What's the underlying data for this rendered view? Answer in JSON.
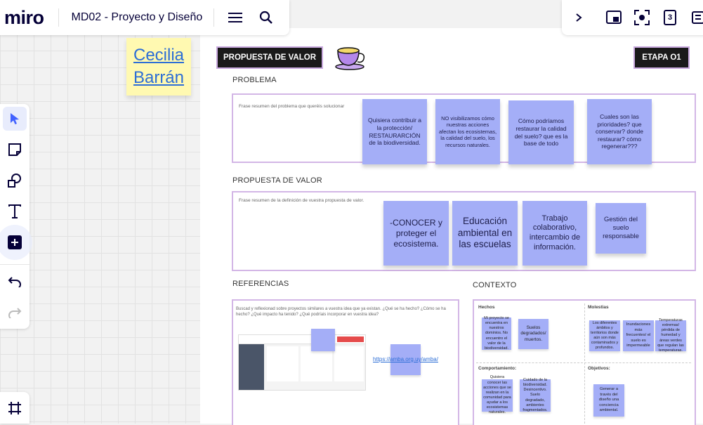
{
  "app": {
    "logo": "miro",
    "board_title": "MD02 - Proyecto y Diseño"
  },
  "colors": {
    "sticky_blue": "#a4aef7",
    "sticky_yellow": "#fff9b1",
    "frame_border": "#d3b6e6",
    "tag_bg": "#1a1a1a",
    "tool_active": "#4262ff"
  },
  "right_toolbar": {
    "chevron": "chevron-right-icon",
    "count": "3"
  },
  "name_note": {
    "line1": "Cecilia",
    "line2": "Barrán"
  },
  "tags": {
    "propuesta": "PROPUESTA DE VALOR",
    "etapa": "ETAPA O1"
  },
  "problema": {
    "label": "PROBLEMA",
    "hint": "Frase resumen del problema que queréis solucionar",
    "notes": [
      "Quisiera contribuir a la protección/ RESTAURARCIÓN de la biodiversidad.",
      "NO visibilizamos cómo nuestras acciones afectan los ecosistemas, la calidad del suelo, los recursos naturales.",
      "Cómo podríamos restaurar la calidad del suelo? que es la base de todo",
      "Cuales son las prioridades? que conservar? donde restaurar? cómo regenerar???"
    ]
  },
  "propuesta": {
    "label": "PROPUESTA DE VALOR",
    "hint": "Frase resumen de la definición de vuestra propuesta de valor.",
    "notes": [
      "-CONOCER y proteger el ecosistema.",
      "Educación ambiental en las escuelas",
      "Trabajo colaborativo, intercambio de información.",
      "Gestión del suelo responsable"
    ]
  },
  "referencias": {
    "label": "REFERENCIAS",
    "hint": "Buscad y reflexionad sobre proyectos similares a vuestra idea que ya existan. ¿Qué se ha hecho? ¿Cómo se ha hecho? ¿Qué impacto ha tenido? ¿Qué podríais incorporar en vuestra idea?",
    "link_note": "https://amba.org.uy/amba/"
  },
  "contexto": {
    "label": "CONTEXTO",
    "hechos": {
      "title": "Hechos",
      "notes": [
        "Mi proyecto se encuentra en nuestros dominios. No encuentro el valor de la biodiversidad.",
        "Suelos degradados/ muertos."
      ]
    },
    "molestias": {
      "title": "Molestias",
      "notes": [
        "Los diferentes ámbitos y territorios donde aún son más contaminados y profundos.",
        "Inundaciones más frecuentes/ el suelo es impermeable",
        "Temperaturas extremas/ pérdida de humedad y áreas verdes que regulan las temperaturas."
      ]
    },
    "comportamiento": {
      "title": "Comportamiento:",
      "notes": [
        "Quisiera conocer las acciones que se realizan en la comunidad para ayudar a los ecosistemas naturales.",
        "Cuidado de la biodiversidad. Desincentivo. Suelo degradado, ambientes fragmentados."
      ]
    },
    "objetivos": {
      "title": "Objetivos:",
      "notes": [
        "Generar a través del diseño una conciencia ambiental."
      ]
    }
  }
}
